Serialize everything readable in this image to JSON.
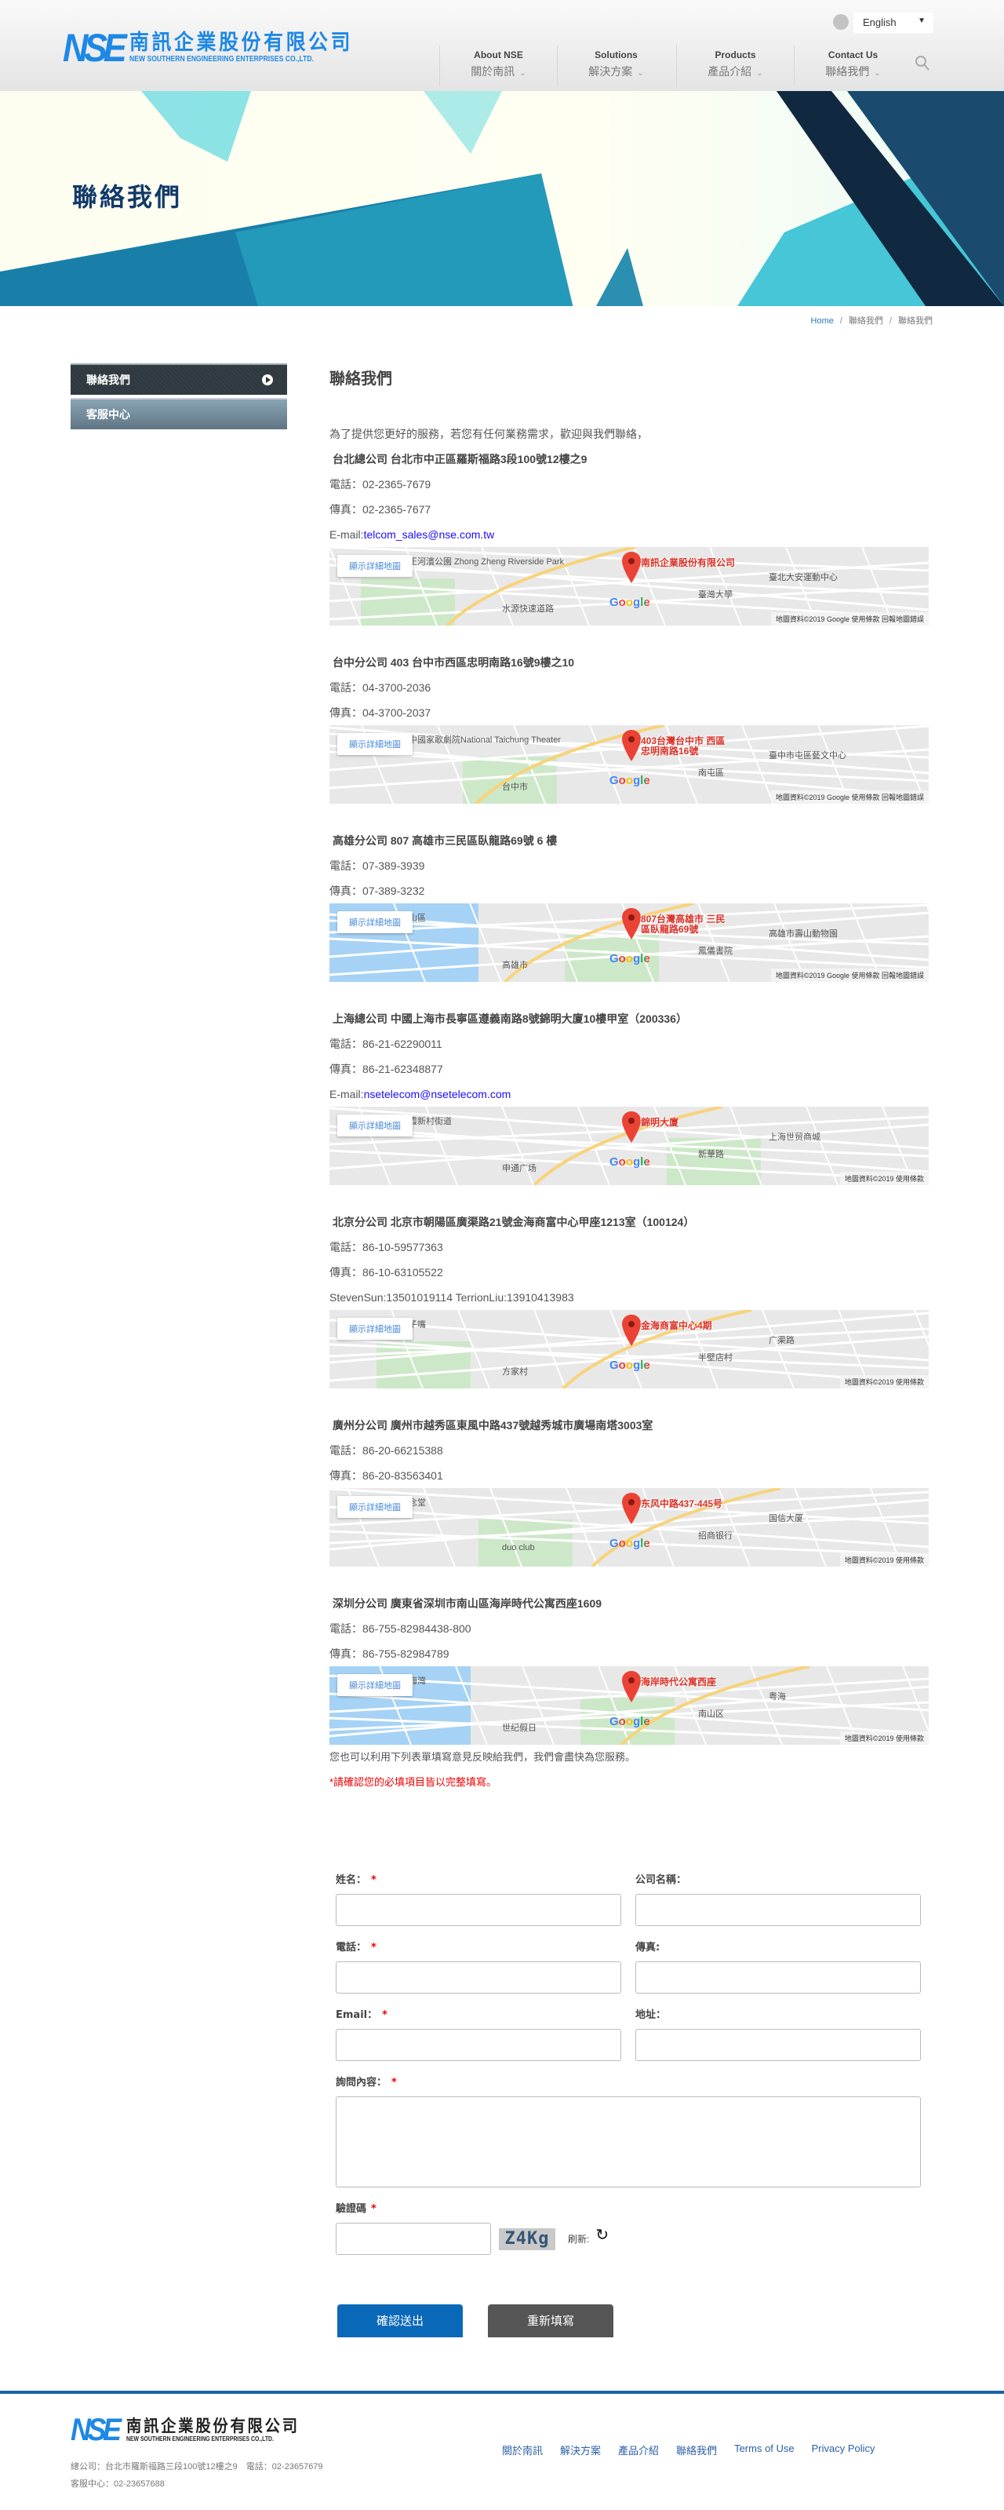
{
  "header": {
    "logo": {
      "mark": "NSE",
      "name_cn": "南訊企業股份有限公司",
      "name_en": "NEW SOUTHERN ENGINEERING ENTERPRISES CO.,LTD."
    },
    "language": "English",
    "nav": [
      {
        "en": "About NSE",
        "cn": "關於南訊"
      },
      {
        "en": "Solutions",
        "cn": "解決方案"
      },
      {
        "en": "Products",
        "cn": "產品介紹"
      },
      {
        "en": "Contact Us",
        "cn": "聯絡我們"
      }
    ]
  },
  "banner": {
    "title": "聯絡我們"
  },
  "breadcrumb": [
    "Home",
    "聯絡我們",
    "聯絡我們"
  ],
  "sidebar": {
    "items": [
      {
        "label": "聯絡我們",
        "active": true
      },
      {
        "label": "客服中心",
        "active": false
      }
    ]
  },
  "main": {
    "title": "聯絡我們",
    "intro": "為了提供您更好的服務，若您有任何業務需求，歡迎與我們聯絡，",
    "offices": [
      {
        "heading": "台北總公司 台北市中正區羅斯福路3段100號12樓之9",
        "phone": "電話：02-2365-7679",
        "fax": "傳真：02-2365-7677",
        "email_prefix": "E-mail:",
        "email": "telcom_sales@nse.com.tw",
        "map": {
          "pin_label": "南訊企業股份有限公司",
          "landmarks": [
            "中正河濱公園 Zhong Zheng Riverside Park",
            "臺北大安運動中心",
            "臺灣大學",
            "水源快速道路"
          ],
          "attribution": "地圖資料©2019 Google  使用條款  回報地圖錯誤"
        }
      },
      {
        "heading": "台中分公司 403 台中市西區忠明南路16號9樓之10",
        "phone": "電話：04-3700-2036",
        "fax": "傳真：04-3700-2037",
        "map": {
          "pin_label": "403台灣台中市 西區忠明南路16號",
          "landmarks": [
            "臺中國家歌劇院National Taichung Theater",
            "臺中市屯區藝文中心",
            "南屯區",
            "台中市"
          ],
          "attribution": "地圖資料©2019 Google  使用條款  回報地圖錯誤"
        }
      },
      {
        "heading": "高雄分公司 807 高雄市三民區臥龍路69號 6 樓",
        "phone": "電話：07-389-3939",
        "fax": "傳真：07-389-3232",
        "map": {
          "pin_label": "807台灣高雄市 三民區臥龍路69號",
          "landmarks": [
            "鼓山區",
            "高雄市壽山動物園",
            "鳳儀書院",
            "高雄市"
          ],
          "attribution": "地圖資料©2019 Google  使用條款  回報地圖錯誤"
        }
      },
      {
        "heading": "上海總公司 中國上海市長寧區遵義南路8號錦明大廈10樓甲室（200336）",
        "phone": "電話：86-21-62290011",
        "fax": "傳真：86-21-62348877",
        "email_prefix": "E-mail:",
        "email": "nsetelecom@nsetelecom.com",
        "map": {
          "pin_label": "錦明大廈",
          "landmarks": [
            "仙霞新村街道",
            "上海世贸商城",
            "新華路",
            "申通广场"
          ],
          "attribution": "地圖資料©2019  使用條款"
        }
      },
      {
        "heading": "北京分公司 北京市朝陽區廣渠路21號金海商富中心甲座1213室（100124）",
        "phone": "電話：86-10-59577363",
        "fax": "傳真：86-10-63105522",
        "extra": "StevenSun:13501019114 TerrionLiu:13910413983",
        "map": {
          "pin_label": "金海商富中心4期",
          "landmarks": [
            "鸭子嘴",
            "广渠路",
            "半壁店村",
            "方家村"
          ],
          "attribution": "地圖資料©2019  使用條款"
        }
      },
      {
        "heading": "廣州分公司 廣州市越秀區東風中路437號越秀城市廣場南塔3003室",
        "phone": "電話：86-20-66215388",
        "fax": "傳真：86-20-83563401",
        "map": {
          "pin_label": "东风中路437-445号",
          "landmarks": [
            "纪念堂",
            "国信大厦",
            "招商银行",
            "duo club"
          ],
          "attribution": "地圖資料©2019  使用條款"
        }
      },
      {
        "heading": "深圳分公司 廣東省深圳市南山區海岸時代公寓西座1609",
        "phone": "電話：86-755-82984438-800",
        "fax": "傳真：86-755-82984789",
        "map": {
          "pin_label": "海岸時代公寓西座",
          "landmarks": [
            "前海灣",
            "粤海",
            "南山区",
            "世纪假日"
          ],
          "attribution": "地圖資料©2019  使用條款"
        }
      }
    ],
    "map_button": "顯示詳細地圖",
    "map_logo": "Google",
    "form_intro": "您也可以利用下列表單填寫意見反映給我們，我們會盡快為您服務。",
    "required_note": "*請確認您的必填項目皆以完整填寫。"
  },
  "form": {
    "name_label": "姓名：",
    "company_label": "公司名稱：",
    "phone_label": "電話：",
    "fax_label": "傳真:",
    "email_label": "Email：",
    "address_label": "地址：",
    "message_label": "詢問內容：",
    "captcha_label": "驗證碼",
    "captcha_text": "Z4Kg",
    "refresh_label": "刷新:",
    "required_mark": "*",
    "submit": "確認送出",
    "reset": "重新填寫"
  },
  "footer": {
    "address": "總公司：台北市羅斯福路三段100號12樓之9　電話：02-23657679",
    "service": "客服中心：02-23657688",
    "links": [
      "關於南訊",
      "解決方案",
      "產品介紹",
      "聯絡我們",
      "Terms of Use",
      "Privacy Policy"
    ]
  },
  "colors": {
    "brand": "#1e88e5",
    "submit": "#0a68b8",
    "reset": "#555555",
    "footer_line": "#1663ab",
    "required": "#ee0000",
    "link": "#1a0dff"
  }
}
